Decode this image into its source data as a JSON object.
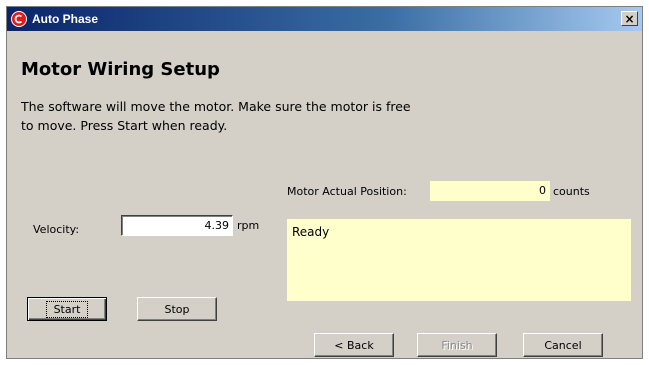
{
  "window": {
    "title": "Auto Phase",
    "close_glyph": "×",
    "icon": "app-logo-icon",
    "close_icon": "close-icon"
  },
  "page": {
    "heading": "Motor Wiring Setup",
    "instructions": "The software will move the motor. Make sure the motor is free to move.  Press Start when ready."
  },
  "position": {
    "label": "Motor Actual Position:",
    "value": "0",
    "unit": "counts"
  },
  "velocity": {
    "label": "Velocity:",
    "value": "4.39",
    "unit": "rpm"
  },
  "status": {
    "text": "Ready"
  },
  "buttons": {
    "start": "Start",
    "stop": "Stop",
    "back": "< Back",
    "finish": "Finish",
    "cancel": "Cancel"
  },
  "colors": {
    "window_bg": "#d4d0c8",
    "readout_bg": "#ffffcc",
    "titlebar_start": "#0a246a",
    "titlebar_end": "#a6caf0",
    "logo_red": "#e41a1a"
  }
}
